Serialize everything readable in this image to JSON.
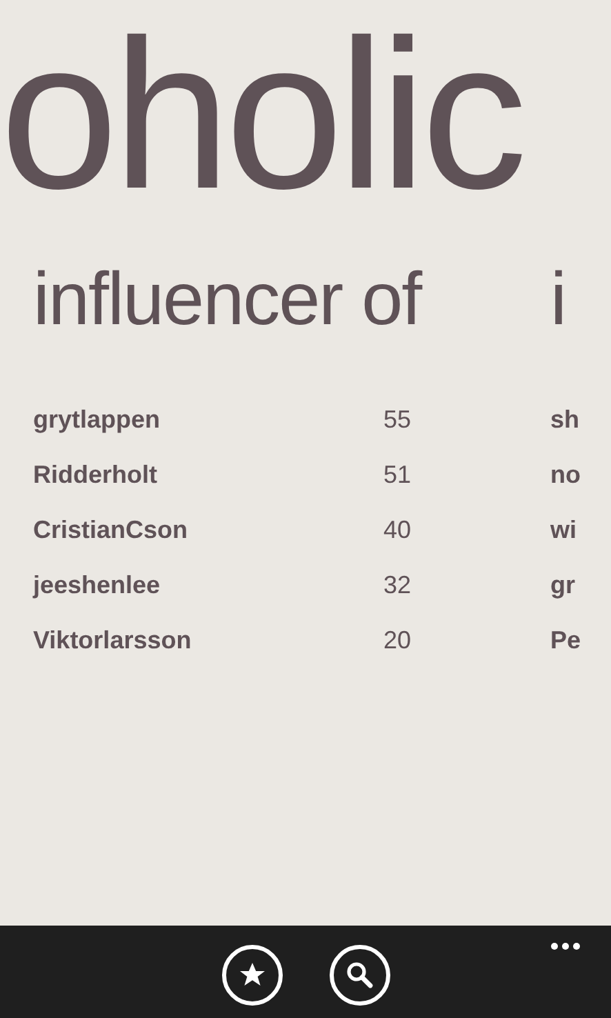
{
  "title": "oholic",
  "sections": [
    {
      "header": "influencer of",
      "rows": [
        {
          "name": "grytlappen",
          "count": "55"
        },
        {
          "name": "Ridderholt",
          "count": "51"
        },
        {
          "name": "CristianCson",
          "count": "40"
        },
        {
          "name": "jeeshenlee",
          "count": "32"
        },
        {
          "name": "Viktorlarsson",
          "count": "20"
        }
      ]
    },
    {
      "header": "i",
      "rows": [
        {
          "name": "sh"
        },
        {
          "name": "no"
        },
        {
          "name": "wi"
        },
        {
          "name": "gr"
        },
        {
          "name": "Pe"
        }
      ]
    }
  ],
  "app_bar": {
    "buttons": [
      {
        "kind": "favorite"
      },
      {
        "kind": "search"
      }
    ]
  }
}
